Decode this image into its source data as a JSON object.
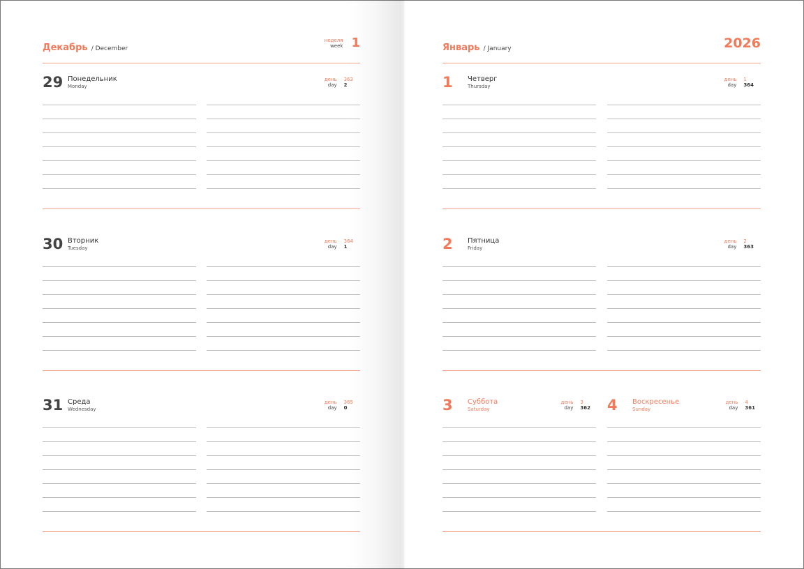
{
  "colors": {
    "accent": "#f07a5a",
    "text": "#3a3a3a",
    "rule": "#bdbdbd"
  },
  "left": {
    "month_ru": "Декабрь",
    "month_en": "/ December",
    "week_label_ru": "неделя",
    "week_label_en": "week",
    "week_number": "1",
    "days": [
      {
        "num": "29",
        "ru": "Понедельник",
        "en": "Monday",
        "lab_ru": "день",
        "lab_en": "day",
        "day_of_year": "363",
        "days_left": "2"
      },
      {
        "num": "30",
        "ru": "Вторник",
        "en": "Tuesday",
        "lab_ru": "день",
        "lab_en": "day",
        "day_of_year": "364",
        "days_left": "1"
      },
      {
        "num": "31",
        "ru": "Среда",
        "en": "Wednesday",
        "lab_ru": "день",
        "lab_en": "day",
        "day_of_year": "365",
        "days_left": "0"
      }
    ]
  },
  "right": {
    "month_ru": "Январь",
    "month_en": "/ January",
    "year": "2026",
    "days": [
      {
        "num": "1",
        "ru": "Четверг",
        "en": "Thursday",
        "lab_ru": "день",
        "lab_en": "day",
        "day_of_year": "1",
        "days_left": "364"
      },
      {
        "num": "2",
        "ru": "Пятница",
        "en": "Friday",
        "lab_ru": "день",
        "lab_en": "day",
        "day_of_year": "2",
        "days_left": "363"
      },
      {
        "num": "3",
        "ru": "Суббота",
        "en": "Saturday",
        "lab_ru": "день",
        "lab_en": "day",
        "day_of_year": "3",
        "days_left": "362"
      },
      {
        "num": "4",
        "ru": "Воскресенье",
        "en": "Sunday",
        "lab_ru": "день",
        "lab_en": "day",
        "day_of_year": "4",
        "days_left": "361"
      }
    ]
  }
}
